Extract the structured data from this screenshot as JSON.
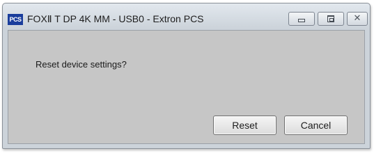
{
  "window": {
    "title": "FOXⅡ T DP 4K MM - USB0 - Extron PCS",
    "app_icon_label": "PCS",
    "icons": {
      "app": "pcs-app-icon",
      "minimize": "minimize-icon",
      "maximize": "maximize-icon",
      "close": "close-icon"
    },
    "close_glyph": "✕"
  },
  "dialog": {
    "message": "Reset device settings?",
    "reset_label": "Reset",
    "cancel_label": "Cancel"
  },
  "colors": {
    "client_background": "#c6c6c6",
    "app_icon_background": "#1a3d9c"
  }
}
